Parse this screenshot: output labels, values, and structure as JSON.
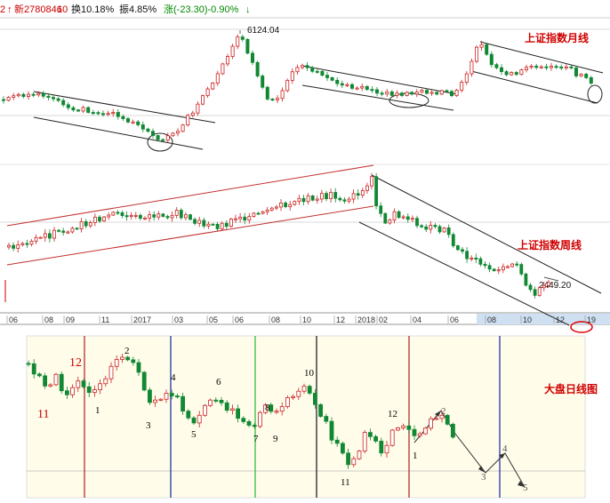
{
  "header": {
    "prefix": "2",
    "arrow_up": "↑",
    "new_label": "新2780846",
    "new_value": "10",
    "turnover": "换10.18%",
    "amplitude": "振4.85%",
    "change": "涨(-23.30)-0.90%",
    "arrow_down": "↓"
  },
  "chart_data": [
    {
      "type": "candlestick",
      "title": "上证指数月线",
      "annotations": [
        {
          "text": "6124.04",
          "kind": "peak"
        }
      ],
      "channels": 3,
      "circled_regions": 3
    },
    {
      "type": "candlestick",
      "title": "上证指数周线",
      "annotations": [
        {
          "text": "2449.20",
          "kind": "low"
        }
      ],
      "x_ticks": [
        "06",
        "08",
        "09",
        "11",
        "2017",
        "03",
        "05",
        "06",
        "08",
        "10",
        "12",
        "2018",
        "02",
        "04",
        "06",
        "08",
        "10",
        "12",
        "19"
      ]
    },
    {
      "type": "candlestick",
      "title": "大盘日线图",
      "wave_labels": [
        "12",
        "11",
        "1",
        "2",
        "3",
        "4",
        "5",
        "6",
        "7",
        "8",
        "9",
        "10",
        "11",
        "12",
        "1",
        "2",
        "3",
        "4",
        "5"
      ]
    }
  ]
}
